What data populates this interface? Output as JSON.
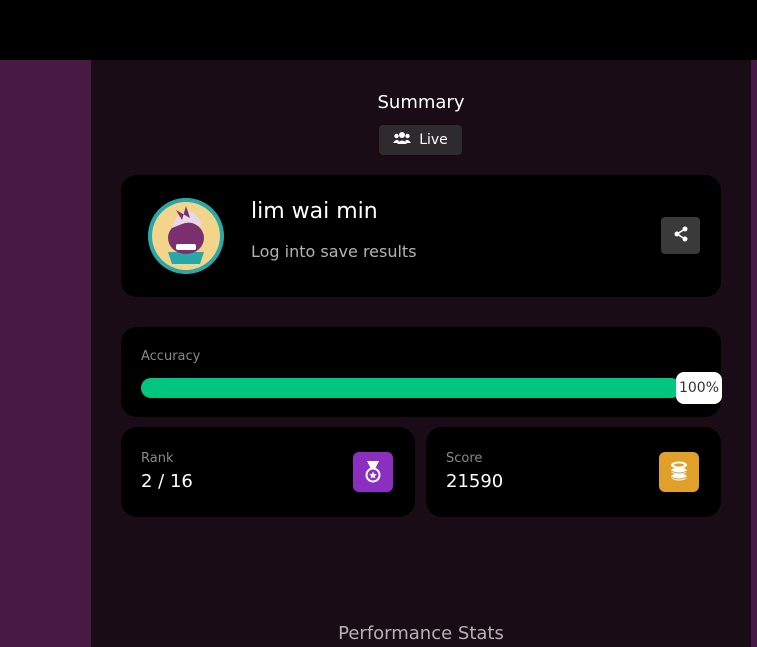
{
  "header": {
    "title": "Summary",
    "mode_badge": "Live",
    "mode_icon": "users-icon"
  },
  "profile": {
    "name": "lim wai min",
    "subtitle": "Log into save results",
    "share_icon": "share-icon"
  },
  "accuracy": {
    "label": "Accuracy",
    "percent_text": "100%",
    "fill_fraction": 1.0
  },
  "stats": {
    "rank": {
      "label": "Rank",
      "value": "2 / 16",
      "icon": "medal-icon"
    },
    "score": {
      "label": "Score",
      "value": "21590",
      "icon": "coins-icon"
    }
  },
  "section": {
    "performance_title": "Performance Stats"
  },
  "colors": {
    "background": "#190c17",
    "side_strip": "#461a42",
    "card": "#000000",
    "accuracy_bar": "#00c680",
    "rank_icon_bg": "#8a2fc0",
    "score_icon_bg": "#e0a02a"
  }
}
